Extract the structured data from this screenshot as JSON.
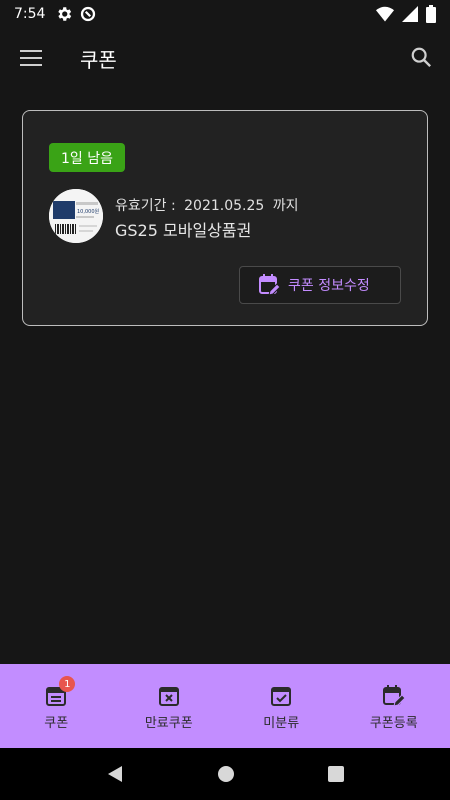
{
  "status_bar": {
    "time": "7:54"
  },
  "app_bar": {
    "title": "쿠폰"
  },
  "coupon": {
    "days_left_badge": "1일 남음",
    "expiry_label": "유효기간 :",
    "expiry_date": "2021.05.25",
    "expiry_suffix": "까지",
    "name": "GS25 모바일상품권",
    "edit_button_label": "쿠폰 정보수정",
    "thumbnail_text": "10,000원"
  },
  "bottom_nav": {
    "items": [
      {
        "label": "쿠폰",
        "icon": "coupon-list-icon",
        "badge": "1"
      },
      {
        "label": "만료쿠폰",
        "icon": "expired-calendar-icon"
      },
      {
        "label": "미분류",
        "icon": "check-calendar-icon"
      },
      {
        "label": "쿠폰등록",
        "icon": "edit-calendar-icon"
      }
    ]
  },
  "colors": {
    "accent": "#c28dff",
    "badge_green": "#3aa316",
    "background": "#161616"
  }
}
